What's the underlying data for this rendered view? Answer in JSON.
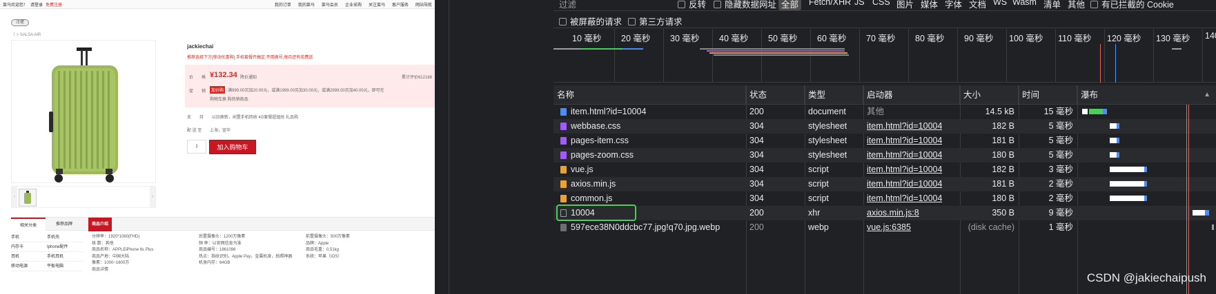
{
  "shop": {
    "topbar": {
      "welcome": "莱马欢迎您！",
      "login": "请登录",
      "register": "免费注册",
      "links": [
        "我的订单",
        "我的莱马",
        "莱马会员",
        "企业采购",
        "关注莱马",
        "客户服务",
        "网站导航"
      ]
    },
    "tag": "汪佬",
    "breadcrumb": "〈   >  SALSA AIR",
    "product_title": "jackiechai",
    "promo_text": "推荐选择下方[移动优惠购],手机套餐齐搞定,不用换号,每月还有花费送",
    "price_label": "价　　格",
    "price": "¥132.34",
    "price_notice": "降价通知",
    "reviews": "累计评价612188",
    "promo_label": "促　　销",
    "promo_badge": "加价购",
    "promo_line1": "满999.00另加20.00元，或满1999.00另加30.00元，或满2999.00另加40.00元，即可在",
    "promo_line2": "购物车换 购热销商品",
    "support_label": "支　　持",
    "support_text": "以旧换新，闲置手机回收 4G套餐超值抢 礼品购",
    "delivery_label": "配 送 至",
    "delivery_text": "上海，宣华",
    "qty": "1",
    "add_to_cart": "加入购物车",
    "tabs": [
      "相关分类",
      "推荐品牌"
    ],
    "intro_tab": "商品介绍",
    "categories": [
      [
        "手机",
        "手机壳"
      ],
      [
        "内存卡",
        "Iphone配件"
      ],
      [
        "耳机",
        "手机耳机"
      ],
      [
        "移动电源",
        "平板电脑"
      ]
    ],
    "specs": [
      [
        "分辨率：1920*1080(FHD)",
        "后置摄像头：1200万像素",
        "前置摄像头：500万像素"
      ],
      [
        "核 数：其他",
        "频 率：以官网信息为准",
        "品牌：Apple"
      ],
      [
        "商品名称：APPLEiPhone 6s Plus",
        "商品编号：1861098",
        "商品毛重：0.51kg"
      ],
      [
        "商品产地：中国大陆",
        "热点：指纹识别，Apple Pay，金属机身，拍照神器",
        "系统：苹果（IOS）"
      ],
      [
        "像素：1000~1600万",
        "机身内存：64GB",
        ""
      ],
      [
        "商品详情",
        "",
        ""
      ]
    ]
  },
  "devtools": {
    "filter_placeholder": "过滤",
    "invert": "反转",
    "hide_data_urls": "隐藏数据网址",
    "types": [
      "全部",
      "Fetch/XHR",
      "JS",
      "CSS",
      "图片",
      "媒体",
      "字体",
      "文档",
      "WS",
      "Wasm",
      "清单",
      "其他"
    ],
    "blocked_cookies": "有已拦截的 Cookie",
    "blocked_requests": "被屏蔽的请求",
    "third_party": "第三方请求",
    "ticks": [
      "10 毫秒",
      "20 毫秒",
      "30 毫秒",
      "40 毫秒",
      "50 毫秒",
      "60 毫秒",
      "70 毫秒",
      "80 毫秒",
      "90 毫秒",
      "100 毫秒",
      "110 毫秒",
      "120 毫秒",
      "130 毫秒",
      "140"
    ],
    "columns": [
      "名称",
      "状态",
      "类型",
      "启动器",
      "大小",
      "时间",
      "瀑布"
    ],
    "rows": [
      {
        "name": "item.html?id=10004",
        "status": "200",
        "type": "document",
        "initiator": "其他",
        "size": "14.5 kB",
        "time": "15 毫秒",
        "icon": "document-icon"
      },
      {
        "name": "webbase.css",
        "status": "304",
        "type": "stylesheet",
        "initiator": "item.html?id=10004",
        "size": "182 B",
        "time": "5 毫秒",
        "icon": "stylesheet-icon"
      },
      {
        "name": "pages-item.css",
        "status": "304",
        "type": "stylesheet",
        "initiator": "item.html?id=10004",
        "size": "181 B",
        "time": "5 毫秒",
        "icon": "stylesheet-icon"
      },
      {
        "name": "pages-zoom.css",
        "status": "304",
        "type": "stylesheet",
        "initiator": "item.html?id=10004",
        "size": "180 B",
        "time": "5 毫秒",
        "icon": "stylesheet-icon"
      },
      {
        "name": "vue.js",
        "status": "304",
        "type": "script",
        "initiator": "item.html?id=10004",
        "size": "182 B",
        "time": "3 毫秒",
        "icon": "script-icon"
      },
      {
        "name": "axios.min.js",
        "status": "304",
        "type": "script",
        "initiator": "item.html?id=10004",
        "size": "181 B",
        "time": "2 毫秒",
        "icon": "script-icon"
      },
      {
        "name": "common.js",
        "status": "304",
        "type": "script",
        "initiator": "item.html?id=10004",
        "size": "180 B",
        "time": "2 毫秒",
        "icon": "script-icon"
      },
      {
        "name": "10004",
        "status": "200",
        "type": "xhr",
        "initiator": "axios.min.js:8",
        "size": "350 B",
        "time": "9 毫秒",
        "icon": "xhr-icon"
      },
      {
        "name": "597ece38N0ddcbc77.jpg!q70.jpg.webp",
        "status": "200",
        "type": "webp",
        "initiator": "vue.js:6385",
        "size": "(disk cache)",
        "time": "1 毫秒",
        "icon": "image-icon"
      }
    ],
    "watermark": "CSDN @jakiechaipush",
    "sort_glyph": "▲",
    "colors": {
      "document": "#4d8cf5",
      "stylesheet": "#9d5ef2",
      "script": "#e9a13b",
      "xhr": "#9aa0a6",
      "image": "#9aa0a6",
      "highlight": "#4ccf5a"
    }
  }
}
